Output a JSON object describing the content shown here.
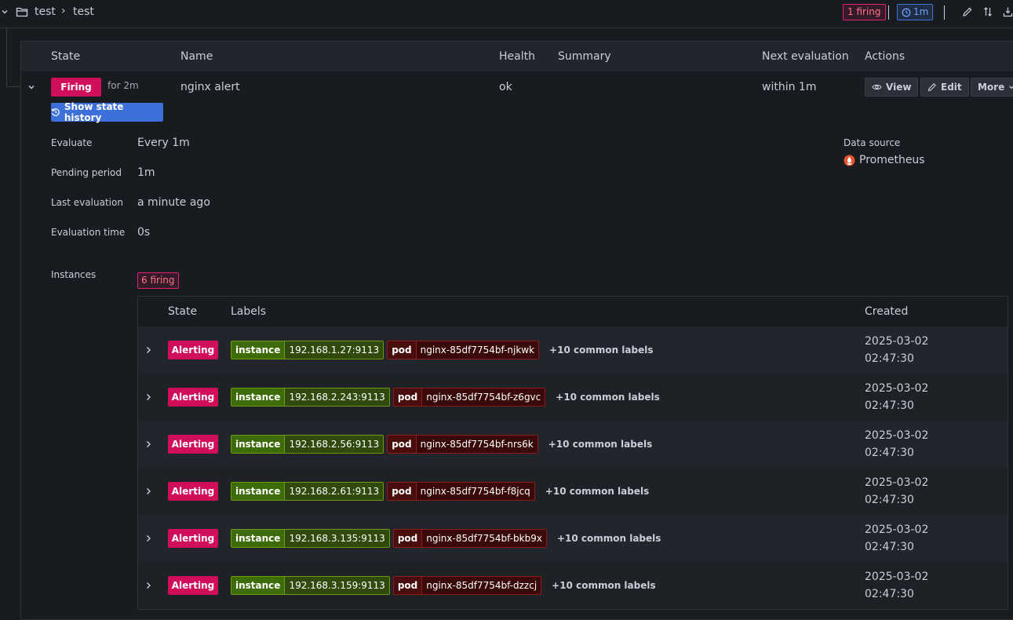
{
  "header": {
    "folder": "test",
    "separator": "›",
    "group": "test",
    "firing_badge": "1 firing",
    "interval_badge": "1m"
  },
  "table": {
    "columns": [
      "State",
      "Name",
      "Health",
      "Summary",
      "Next evaluation",
      "Actions"
    ]
  },
  "rule": {
    "state": "Firing",
    "duration": "for 2m",
    "name": "nginx alert",
    "health": "ok",
    "next_evaluation": "within 1m",
    "actions": {
      "view": "View",
      "edit": "Edit",
      "more": "More"
    },
    "show_history": "Show state history"
  },
  "details": {
    "evaluate_label": "Evaluate",
    "evaluate_value": "Every 1m",
    "pending_label": "Pending period",
    "pending_value": "1m",
    "last_eval_label": "Last evaluation",
    "last_eval_value": "a minute ago",
    "eval_time_label": "Evaluation time",
    "eval_time_value": "0s",
    "datasource_label": "Data source",
    "datasource_value": "Prometheus",
    "instances_label": "Instances",
    "instances_badge": "6 firing"
  },
  "instances": {
    "columns": [
      "State",
      "Labels",
      "Created"
    ],
    "rows": [
      {
        "state": "Alerting",
        "instance_key": "instance",
        "instance": "192.168.1.27:9113",
        "pod_key": "pod",
        "pod": "nginx-85df7754bf-njkwk",
        "common": "+10 common labels",
        "created_date": "2025-03-02",
        "created_time": "02:47:30"
      },
      {
        "state": "Alerting",
        "instance_key": "instance",
        "instance": "192.168.2.243:9113",
        "pod_key": "pod",
        "pod": "nginx-85df7754bf-z6gvc",
        "common": "+10 common labels",
        "created_date": "2025-03-02",
        "created_time": "02:47:30"
      },
      {
        "state": "Alerting",
        "instance_key": "instance",
        "instance": "192.168.2.56:9113",
        "pod_key": "pod",
        "pod": "nginx-85df7754bf-nrs6k",
        "common": "+10 common labels",
        "created_date": "2025-03-02",
        "created_time": "02:47:30"
      },
      {
        "state": "Alerting",
        "instance_key": "instance",
        "instance": "192.168.2.61:9113",
        "pod_key": "pod",
        "pod": "nginx-85df7754bf-f8jcq",
        "common": "+10 common labels",
        "created_date": "2025-03-02",
        "created_time": "02:47:30"
      },
      {
        "state": "Alerting",
        "instance_key": "instance",
        "instance": "192.168.3.135:9113",
        "pod_key": "pod",
        "pod": "nginx-85df7754bf-bkb9x",
        "common": "+10 common labels",
        "created_date": "2025-03-02",
        "created_time": "02:47:30"
      },
      {
        "state": "Alerting",
        "instance_key": "instance",
        "instance": "192.168.3.159:9113",
        "pod_key": "pod",
        "pod": "nginx-85df7754bf-dzzcj",
        "common": "+10 common labels",
        "created_date": "2025-03-02",
        "created_time": "02:47:30"
      }
    ]
  },
  "colors": {
    "background": "#181b1f",
    "firing": "#d10e5c",
    "primary": "#3d71d9",
    "label_green": "#3d6b08",
    "label_red": "#4a0d0d",
    "prometheus": "#e6522c"
  }
}
